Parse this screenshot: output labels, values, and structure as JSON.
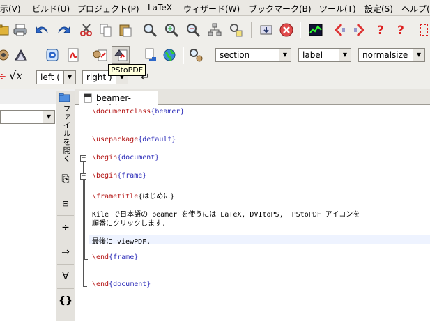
{
  "menubar": {
    "items": [
      "示(V)",
      "ビルド(U)",
      "プロジェクト(P)",
      "LaTeX",
      "ウィザード(W)",
      "ブックマーク(B)",
      "ツール(T)",
      "設定(S)",
      "ヘルプ("
    ]
  },
  "toolbar3": {
    "left_delim": "left (",
    "right_delim": "right )"
  },
  "combos": {
    "section": "section",
    "label": "label",
    "size": "normalsize"
  },
  "tooltip": "PStoPDF",
  "sidebar": {
    "file_tab_label": "ファイルを開く",
    "buttons": [
      "⎘",
      "⊟",
      "÷",
      "⇒",
      "∀",
      "{}"
    ]
  },
  "editor": {
    "tab_title": "beamer-test.tex",
    "lines": {
      "l1": "\\documentclass{beamer}",
      "l2": "\\usepackage{default}",
      "l3": "\\begin{document}",
      "l4": "\\begin{frame}",
      "l5": "\\frametitle{はじめに}",
      "l6": "Kile で日本語の beamer を使うには LaTeX, DVItoPS,  PStoPDF アイコンを",
      "l7": "順番にクリックします.",
      "l8": "最後に viewPDF.",
      "l9": "\\end{frame}",
      "l10": "\\end{document}"
    }
  }
}
